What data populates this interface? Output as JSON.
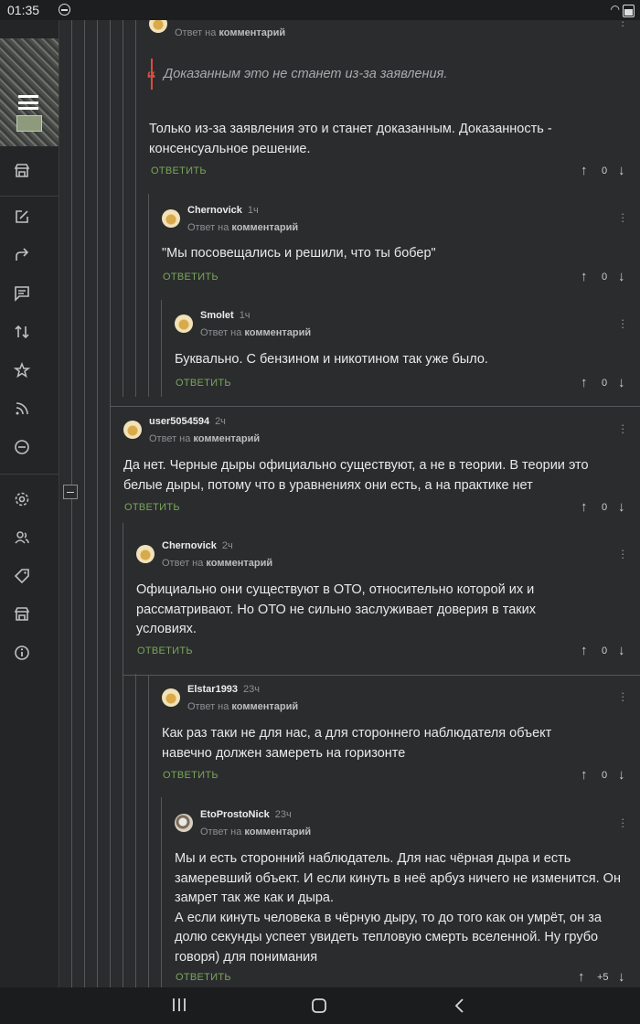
{
  "statusbar": {
    "time": "01:35"
  },
  "comments": [
    {
      "id": "c0",
      "reply_to": [
        "Ответ на",
        "комментарий"
      ],
      "quote": "Доказанным это не станет из-за заявления.",
      "text": "Только из-за заявления это и станет доказанным. Доказанность - консенсуальное решение.",
      "answer": "ОТВЕТИТЬ",
      "votes": "0"
    },
    {
      "id": "c1",
      "author": "Chernovick",
      "time": "1ч",
      "reply_to": [
        "Ответ на",
        "комментарий"
      ],
      "text": "\"Мы посовещались и решили, что ты бобер\"",
      "answer": "ОТВЕТИТЬ",
      "votes": "0"
    },
    {
      "id": "c2",
      "author": "Smolet",
      "time": "1ч",
      "reply_to": [
        "Ответ на",
        "комментарий"
      ],
      "text": "Буквально. С бензином и никотином так уже было.",
      "answer": "ОТВЕТИТЬ",
      "votes": "0"
    },
    {
      "id": "c3",
      "author": "user5054594",
      "time": "2ч",
      "reply_to": [
        "Ответ на",
        "комментарий"
      ],
      "text": "Да нет. Черные дыры официально существуют, а не в теории. В теории это белые дыры, потому что в уравнениях они есть, а на практике нет",
      "answer": "ОТВЕТИТЬ",
      "votes": "0"
    },
    {
      "id": "c4",
      "author": "Chernovick",
      "time": "2ч",
      "reply_to": [
        "Ответ на",
        "комментарий"
      ],
      "text": "Официально они существуют в ОТО, относительно которой их и рассматривают. Но ОТО не сильно заслуживает доверия в таких условиях.",
      "answer": "ОТВЕТИТЬ",
      "votes": "0"
    },
    {
      "id": "c5",
      "author": "Elstar1993",
      "time": "23ч",
      "reply_to": [
        "Ответ на",
        "комментарий"
      ],
      "text": "Как раз таки не для нас, а для стороннего наблюдателя объект навечно должен замереть на горизонте",
      "answer": "ОТВЕТИТЬ",
      "votes": "0"
    },
    {
      "id": "c6",
      "author": "EtoProstoNick",
      "time": "23ч",
      "reply_to": [
        "Ответ на",
        "комментарий"
      ],
      "text": "Мы и есть сторонний наблюдатель. Для нас чёрная дыра и есть замеревший объект. И если кинуть в неё арбуз ничего не изменится. Он замрет так же как и дыра.\nА если кинуть человека в чёрную дыру, то до того как он умрёт, он за долю секунды успеет увидеть тепловую смерть вселенной. Ну грубо говоря) для понимания",
      "answer": "ОТВЕТИТЬ",
      "votes": "+5"
    }
  ]
}
